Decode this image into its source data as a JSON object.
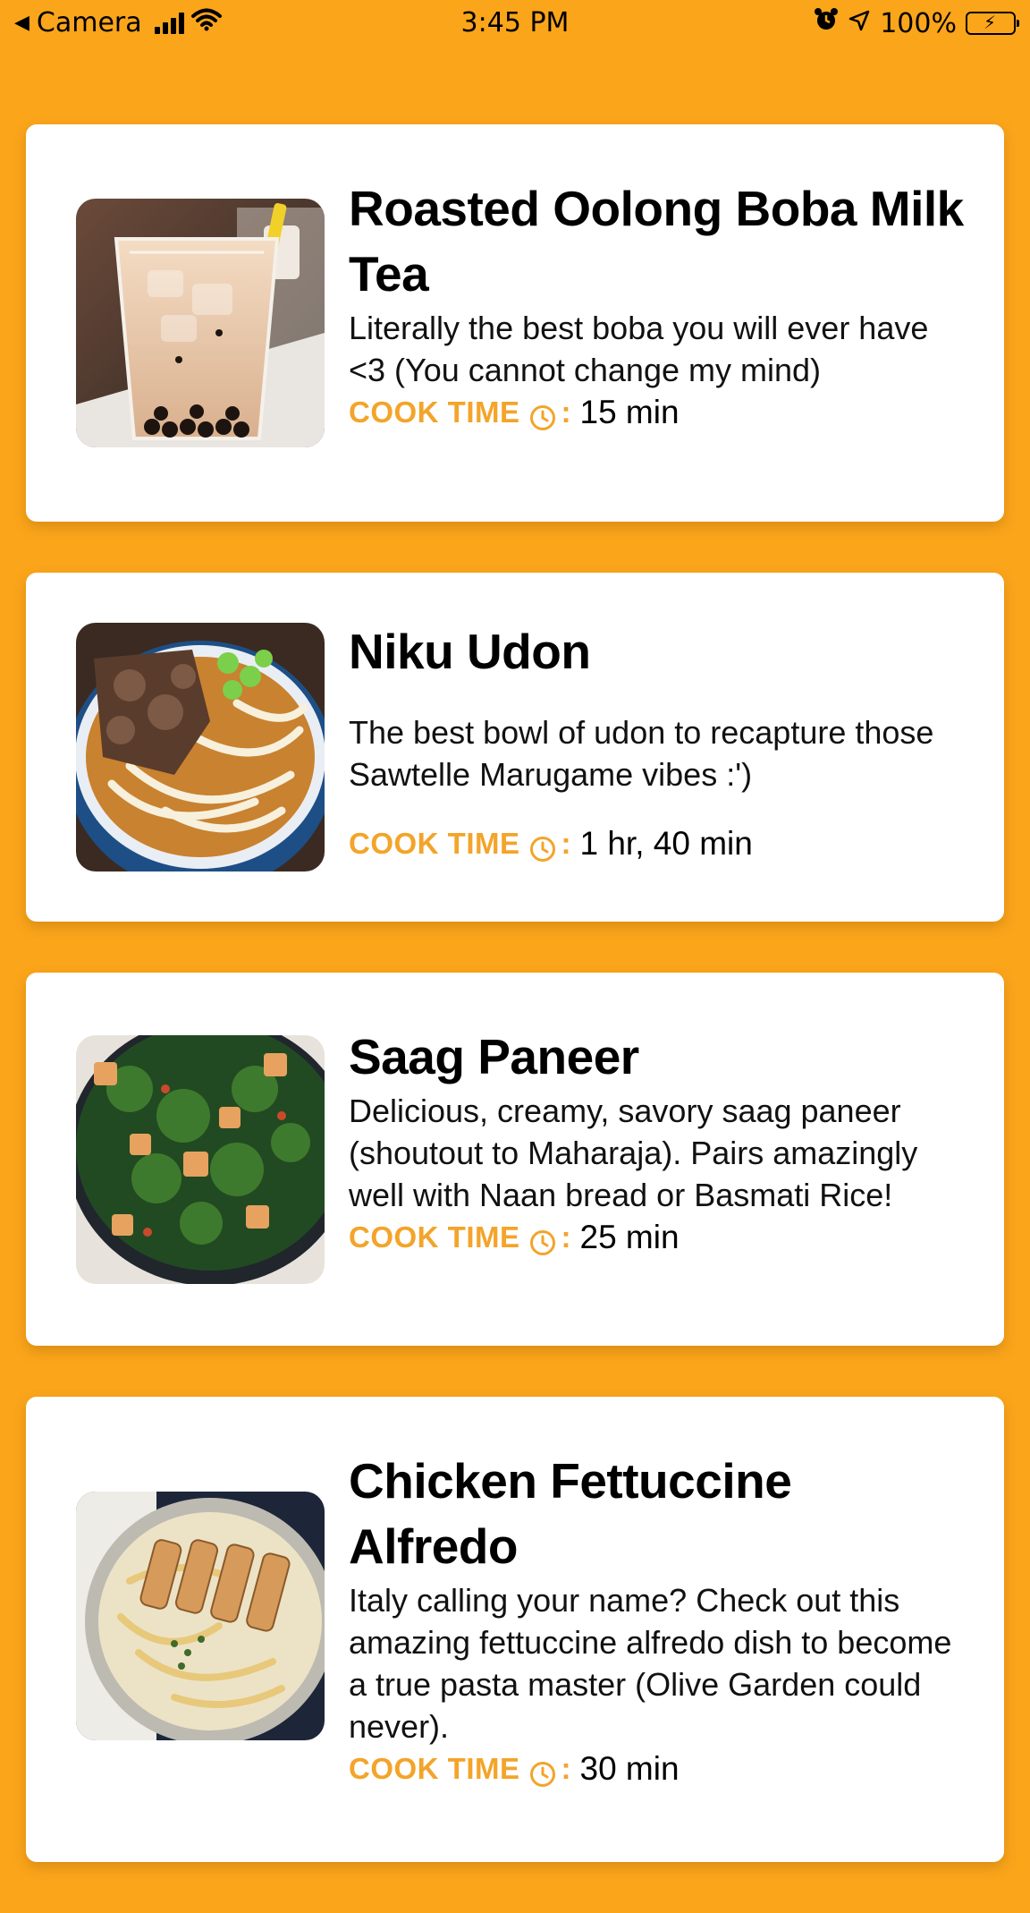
{
  "status_bar": {
    "back_app": "Camera",
    "time": "3:45 PM",
    "battery": "100%"
  },
  "colors": {
    "background": "#FBA51B",
    "accent": "#F3A42A",
    "card": "#FFFFFF"
  },
  "cook_time_label": "COOK TIME",
  "recipes": [
    {
      "title": "Roasted Oolong Boba Milk Tea",
      "description": "Literally the best boba you will ever have <3 (You cannot change my mind)",
      "cook_time": "15 min",
      "image": "boba-milk-tea-image"
    },
    {
      "title": "Niku Udon",
      "description": "The best bowl of udon to recapture those Sawtelle Marugame vibes :')",
      "cook_time": "1 hr, 40 min",
      "image": "udon-bowl-image"
    },
    {
      "title": "Saag Paneer",
      "description": "Delicious, creamy, savory saag paneer (shoutout to Maharaja). Pairs amazingly well with Naan bread or Basmati Rice!",
      "cook_time": "25 min",
      "image": "saag-paneer-image"
    },
    {
      "title": "Chicken Fettuccine Alfredo",
      "description": "Italy calling your name? Check out this amazing fettuccine alfredo dish to become a true pasta master (Olive Garden could never).",
      "cook_time": "30 min",
      "image": "fettuccine-alfredo-image"
    }
  ]
}
